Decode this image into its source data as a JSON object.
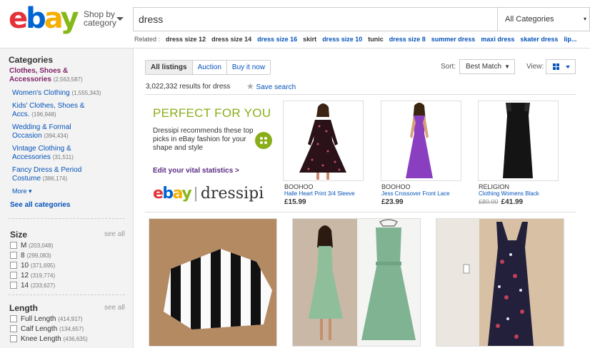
{
  "header": {
    "shop_by_line1": "Shop by",
    "shop_by_line2": "category",
    "search_value": "dress",
    "category_select": "All Categories"
  },
  "related": {
    "label": "Related :",
    "items": [
      "dress size 12",
      "dress size 14",
      "dress size 16",
      "skirt",
      "dress size 10",
      "tunic",
      "dress size 8",
      "summer dress",
      "maxi dress",
      "skater dress",
      "lip..."
    ]
  },
  "sidebar": {
    "categories_title": "Categories",
    "active_category_l1": "Clothes, Shoes &",
    "active_category_l2": "Accessories",
    "active_category_count": "(2,563,587)",
    "items": [
      {
        "l1": "Women's Clothing",
        "l2": "",
        "count": "(1,555,343)"
      },
      {
        "l1": "Kids' Clothes, Shoes &",
        "l2": "Accs.",
        "count": "(196,948)"
      },
      {
        "l1": "Wedding & Formal",
        "l2": "Occasion",
        "count": "(394,434)"
      },
      {
        "l1": "Vintage Clothing &",
        "l2": "Accessories",
        "count": "(31,511)"
      },
      {
        "l1": "Fancy Dress & Period",
        "l2": "Costume",
        "count": "(386,174)"
      }
    ],
    "more": "More",
    "see_all_categories": "See all categories",
    "size_title": "Size",
    "size_see_all": "see all",
    "sizes": [
      {
        "label": "M",
        "count": "(203,048)"
      },
      {
        "label": "8",
        "count": "(299,083)"
      },
      {
        "label": "10",
        "count": "(371,695)"
      },
      {
        "label": "12",
        "count": "(319,774)"
      },
      {
        "label": "14",
        "count": "(233,627)"
      }
    ],
    "length_title": "Length",
    "length_see_all": "see all",
    "lengths": [
      {
        "label": "Full Length",
        "count": "(414,917)"
      },
      {
        "label": "Calf Length",
        "count": "(134,657)"
      },
      {
        "label": "Knee Length",
        "count": "(436,635)"
      }
    ]
  },
  "toolbar": {
    "tabs": [
      "All listings",
      "Auction",
      "Buy it now"
    ],
    "results": "3,022,332 results for dress",
    "save_search": "Save search",
    "sort_label": "Sort:",
    "sort_value": "Best Match",
    "view_label": "View:"
  },
  "promo": {
    "headline": "PERFECT FOR YOU",
    "text": "Dressipi recommends these top picks in eBay fashion for your shape and style",
    "edit_link": "Edit your vital statistics >",
    "partner": "dressipi"
  },
  "products": [
    {
      "brand": "BOOHOO",
      "title": "Halle Heart Print 3/4 Sleeve",
      "price": "£15.99",
      "old_price": ""
    },
    {
      "brand": "BOOHOO",
      "title": "Jess Crossover Front Lace",
      "price": "£23.99",
      "old_price": ""
    },
    {
      "brand": "RELIGION",
      "title": "Clothing Womens Black",
      "price": "£41.99",
      "old_price": "£80.00"
    }
  ],
  "colors": {
    "ebay_red": "#e53238",
    "ebay_blue": "#0064d2",
    "ebay_yellow": "#f5af02",
    "ebay_green": "#86b817",
    "link_blue": "#0654ba",
    "dressipi_green": "#8aae1a"
  }
}
